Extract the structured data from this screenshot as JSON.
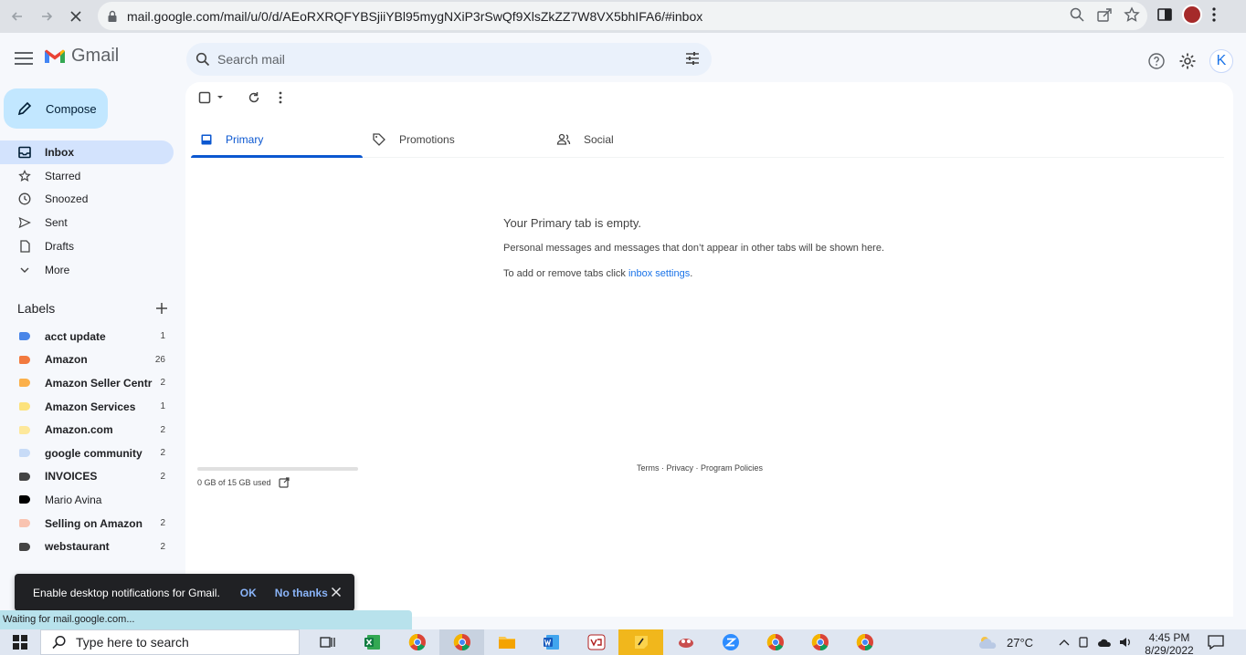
{
  "browser": {
    "url": "mail.google.com/mail/u/0/d/AEoRXRQFYBSjiiYBl95mygNXiP3rSwQf9XlsZkZZ7W8VX5bhIFA6/#inbox"
  },
  "app": {
    "name": "Gmail",
    "search_placeholder": "Search mail",
    "avatar_letter": "K"
  },
  "sidebar": {
    "compose_label": "Compose",
    "nav": [
      {
        "label": "Inbox",
        "icon": "inbox-icon",
        "active": true
      },
      {
        "label": "Starred",
        "icon": "star-icon"
      },
      {
        "label": "Snoozed",
        "icon": "clock-icon"
      },
      {
        "label": "Sent",
        "icon": "send-icon"
      },
      {
        "label": "Drafts",
        "icon": "draft-icon"
      },
      {
        "label": "More",
        "icon": "chevron-down-icon"
      }
    ],
    "labels_title": "Labels",
    "labels": [
      {
        "name": "acct update",
        "count": "1",
        "color": "#4a86e8"
      },
      {
        "name": "Amazon",
        "count": "26",
        "color": "#f27a3f"
      },
      {
        "name": "Amazon Seller Centr",
        "count": "2",
        "color": "#fbb04a"
      },
      {
        "name": "Amazon Services",
        "count": "1",
        "color": "#fce27c"
      },
      {
        "name": "Amazon.com",
        "count": "2",
        "color": "#fde89b"
      },
      {
        "name": "google community",
        "count": "2",
        "color": "#c7dbf7"
      },
      {
        "name": "INVOICES",
        "count": "2",
        "color": "#444444"
      },
      {
        "name": "Mario Avina",
        "count": "",
        "color": "#000000"
      },
      {
        "name": "Selling on Amazon",
        "count": "2",
        "color": "#f9c3b0"
      },
      {
        "name": "webstaurant",
        "count": "2",
        "color": "#444444"
      }
    ]
  },
  "tabs": [
    {
      "label": "Primary",
      "icon": "inbox-tab-icon"
    },
    {
      "label": "Promotions",
      "icon": "tag-icon"
    },
    {
      "label": "Social",
      "icon": "people-icon"
    }
  ],
  "empty_state": {
    "title": "Your Primary tab is empty.",
    "message": "Personal messages and messages that don’t appear in other tabs will be shown here.",
    "settings_prefix": "To add or remove tabs click ",
    "settings_link": "inbox settings",
    "settings_suffix": "."
  },
  "storage": {
    "text": "0 GB of 15 GB used",
    "fraction_used": 0.0
  },
  "footer": {
    "links": "Terms · Privacy · Program Policies"
  },
  "toast": {
    "message": "Enable desktop notifications for Gmail.",
    "ok": "OK",
    "no_thanks": "No thanks"
  },
  "status_bar": "Waiting for mail.google.com...",
  "taskbar": {
    "search_placeholder": "Type here to search",
    "temperature": "27°C",
    "time": "4:45 PM",
    "date": "8/29/2022"
  }
}
